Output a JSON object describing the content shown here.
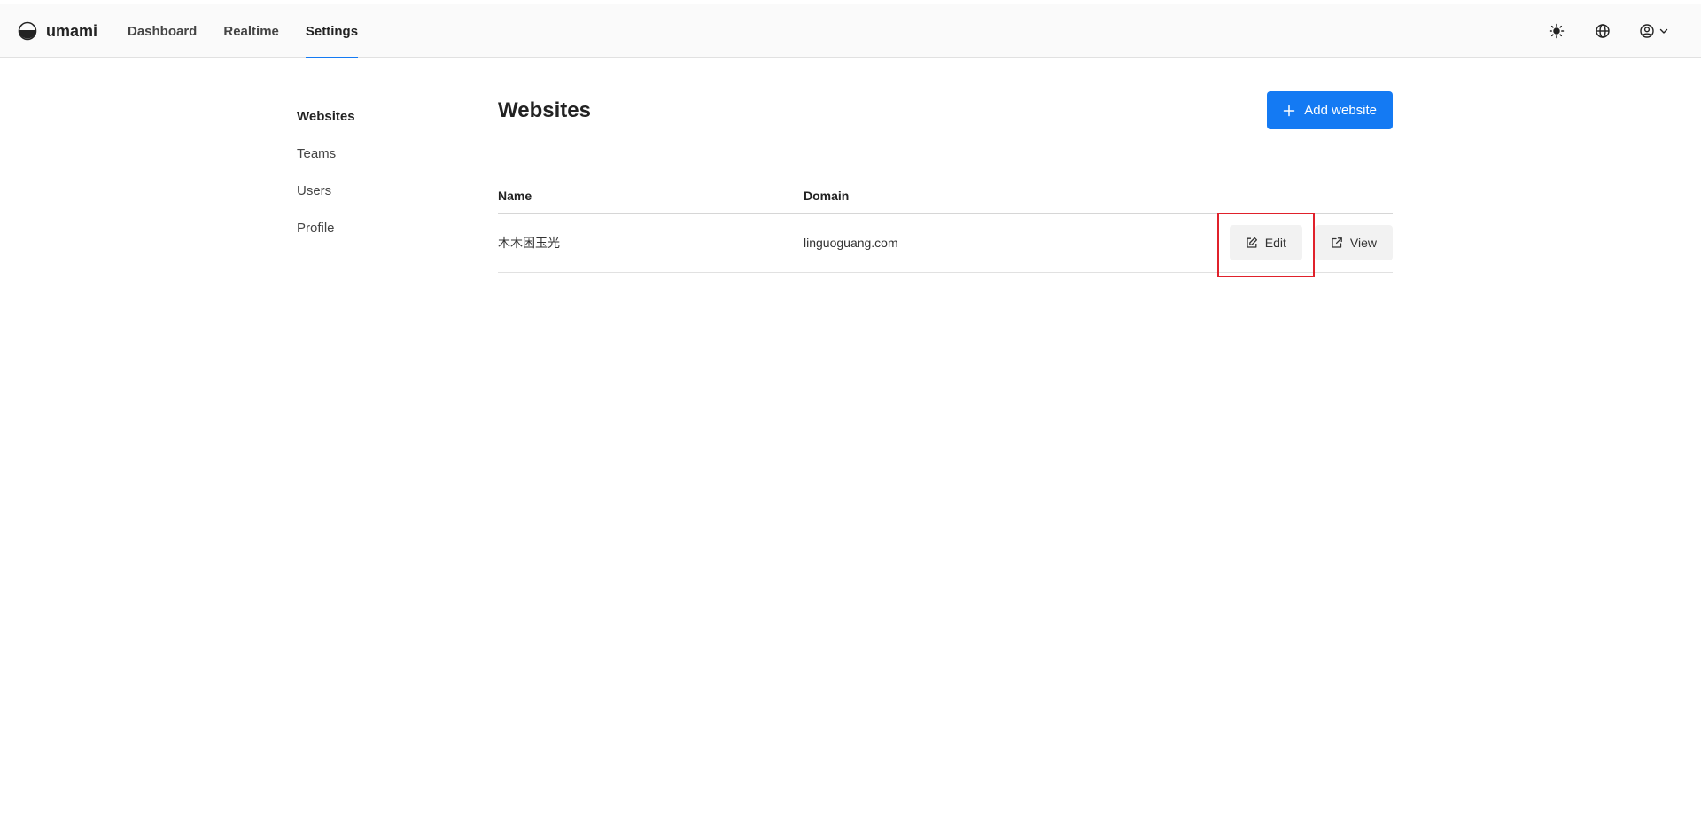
{
  "app": {
    "name": "umami"
  },
  "nav": {
    "items": [
      {
        "label": "Dashboard"
      },
      {
        "label": "Realtime"
      },
      {
        "label": "Settings"
      }
    ],
    "active": "Settings"
  },
  "header_icons": [
    "sun-icon",
    "globe-icon",
    "user-circle-icon",
    "chevron-down-icon"
  ],
  "sidebar": {
    "items": [
      {
        "label": "Websites"
      },
      {
        "label": "Teams"
      },
      {
        "label": "Users"
      },
      {
        "label": "Profile"
      }
    ],
    "active": "Websites"
  },
  "main": {
    "title": "Websites",
    "add_button_label": "Add website",
    "table": {
      "columns": [
        "Name",
        "Domain"
      ],
      "rows": [
        {
          "name": "木木困玉光",
          "domain": "linguoguang.com",
          "edit_label": "Edit",
          "view_label": "View"
        }
      ]
    }
  },
  "colors": {
    "accent": "#147af3",
    "highlight": "#e0212b",
    "header_bg": "#fafafa",
    "secondary_button_bg": "#f2f2f2"
  }
}
